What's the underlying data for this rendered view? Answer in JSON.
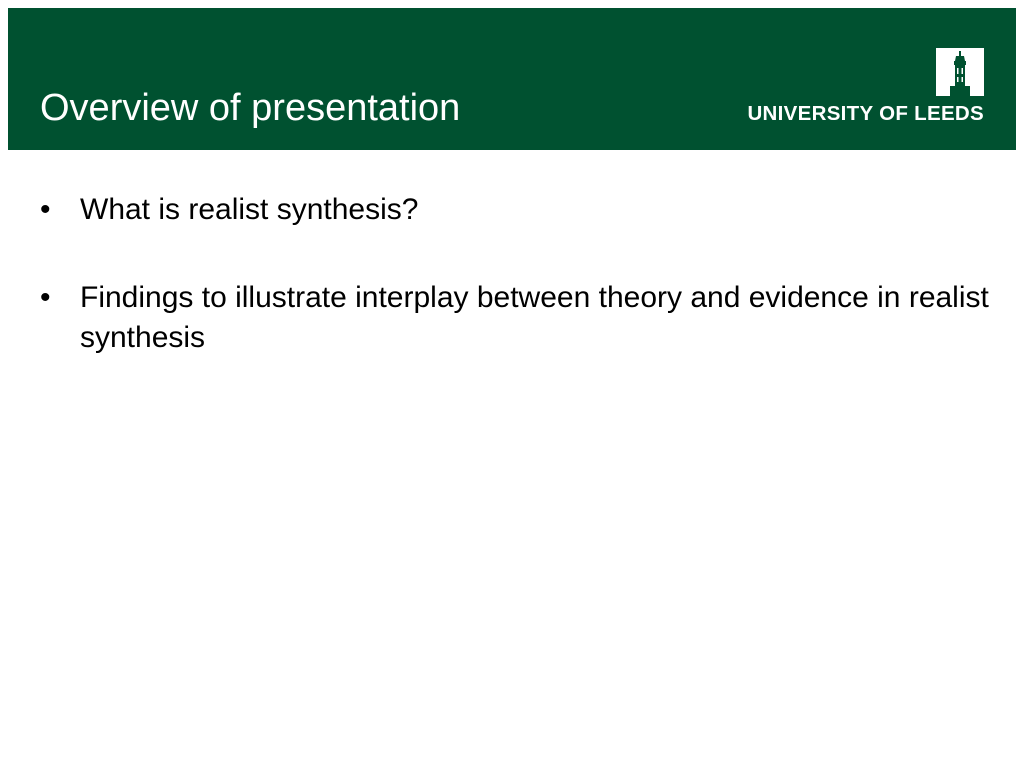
{
  "slide": {
    "title": "Overview of presentation",
    "logo": {
      "text": "UNIVERSITY OF LEEDS",
      "icon": "parkinson-tower-icon"
    },
    "bullet_glyph": "•",
    "bullets": [
      {
        "text": "What is realist synthesis?"
      },
      {
        "text": "Findings to illustrate interplay between theory and evidence in realist synthesis"
      }
    ]
  },
  "colors": {
    "header_bg": "#005130",
    "header_text": "#ffffff",
    "body_text": "#000000",
    "background": "#ffffff"
  }
}
